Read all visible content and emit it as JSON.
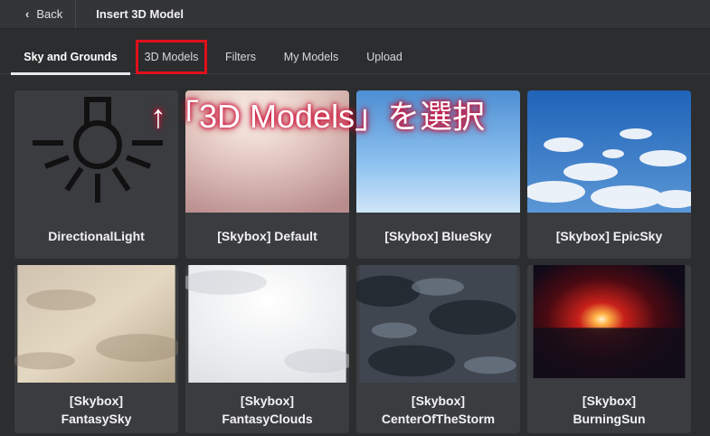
{
  "topbar": {
    "back_label": "Back",
    "title": "Insert 3D Model"
  },
  "tabs": [
    {
      "label": "Sky and Grounds",
      "active": true
    },
    {
      "label": "3D Models",
      "highlighted": true
    },
    {
      "label": "Filters"
    },
    {
      "label": "My Models"
    },
    {
      "label": "Upload"
    }
  ],
  "annotation": "↑「3D Models」を選択",
  "cards": [
    {
      "label": "DirectionalLight",
      "icon": "light-bulb-icon"
    },
    {
      "label": "[Skybox] Default"
    },
    {
      "label": "[Skybox] BlueSky"
    },
    {
      "label": "[Skybox] EpicSky"
    },
    {
      "label_line1": "[Skybox]",
      "label_line2": "FantasySky"
    },
    {
      "label_line1": "[Skybox]",
      "label_line2": "FantasyClouds"
    },
    {
      "label_line1": "[Skybox]",
      "label_line2": "CenterOfTheStorm"
    },
    {
      "label_line1": "[Skybox]",
      "label_line2": "BurningSun"
    }
  ],
  "colors": {
    "highlight": "#e0101a",
    "background": "#2b2d2f",
    "card": "#3a3c3f"
  }
}
